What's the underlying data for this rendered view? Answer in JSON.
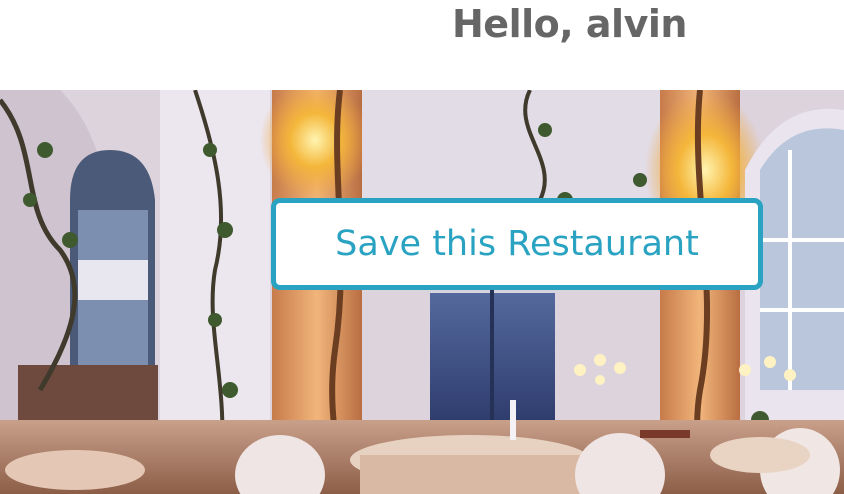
{
  "header": {
    "greeting": "Hello, alvin"
  },
  "hero": {
    "image_description_icon": "restaurant-photo",
    "save_button_label": "Save this Restaurant"
  },
  "colors": {
    "accent": "#2aa3c2",
    "greeting_text": "#666666"
  }
}
